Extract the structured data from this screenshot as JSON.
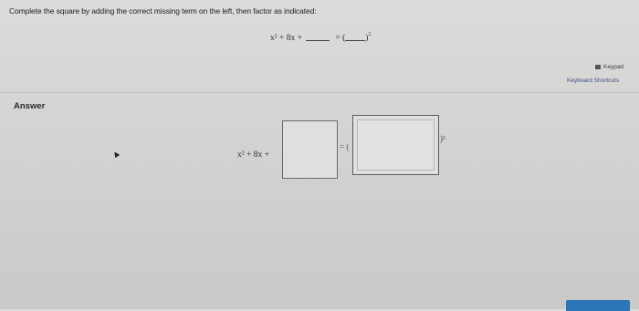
{
  "question": {
    "prompt": "Complete the square by adding the correct missing term on the left, then factor as indicated:",
    "expression_lhs": "x² + 8x +",
    "equals": "=",
    "paren_open": "(",
    "paren_close": ")",
    "exponent": "2"
  },
  "tools": {
    "keypad_label": "Keypad",
    "shortcuts_label": "Keyboard Shortcuts"
  },
  "answer": {
    "label": "Answer",
    "expression_lhs": "x² + 8x +",
    "eq_open": "= (",
    "exp_close": ")²",
    "box_a_value": "",
    "box_b_value": ""
  }
}
